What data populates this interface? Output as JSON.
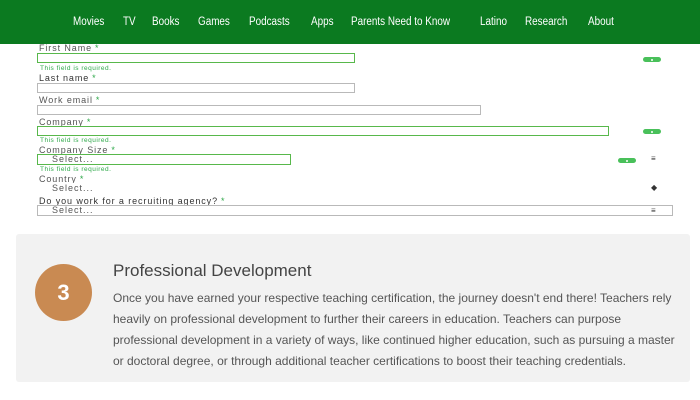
{
  "nav": {
    "items": [
      "Movies",
      "TV",
      "Books",
      "Games",
      "Podcasts",
      "Apps",
      "Parents Need to Know",
      "Latino",
      "Research",
      "About"
    ]
  },
  "form": {
    "first_name_label": "First Name",
    "last_name_label": "Last name",
    "work_email_label": "Work email",
    "company_label": "Company",
    "company_size_label": "Company Size",
    "country_label": "Country",
    "agency_label": "Do you work for a recruiting agency?",
    "required_marker": "*",
    "error_text": "This field is required.",
    "select_placeholder": "Select..."
  },
  "step": {
    "number": "3",
    "title": "Professional Development",
    "body": "Once you have earned your respective teaching certification, the journey doesn't end there! Teachers rely heavily on professional development to further their careers in education. Teachers can purpose professional development in a variety of ways, like continued higher education, such as pursuing a master or doctoral degree, or through additional teacher certifications to boost their teaching credentials."
  },
  "colors": {
    "nav_bg": "#0b7a20",
    "accent_green": "#2fa84a",
    "step_circle": "#c98a52",
    "card_bg": "#f2f2f2"
  }
}
